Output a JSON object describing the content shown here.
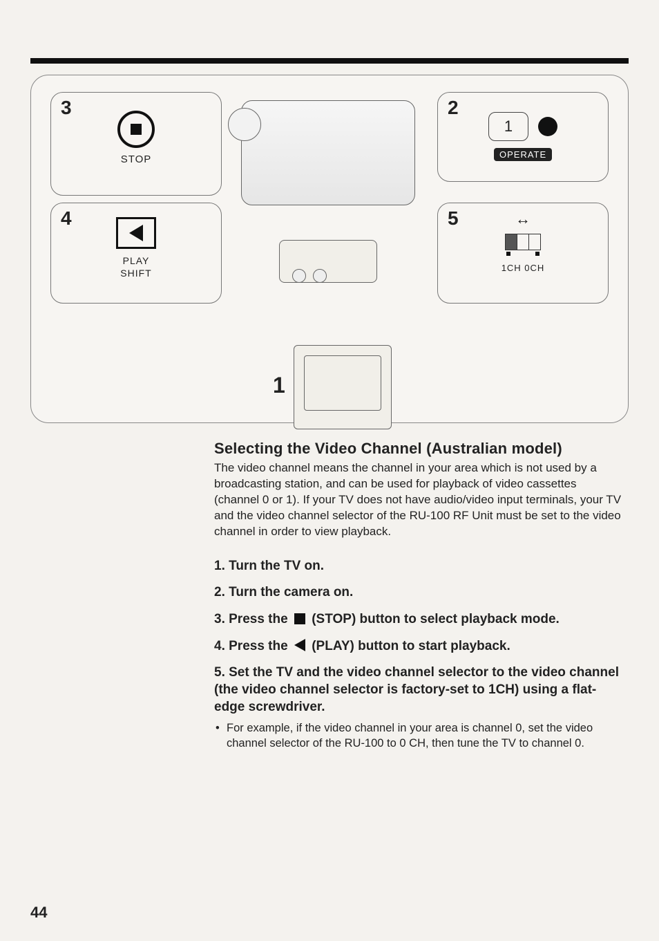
{
  "page_number": "44",
  "figure": {
    "callout3": {
      "num": "3",
      "label": "STOP"
    },
    "callout4": {
      "num": "4",
      "label1": "PLAY",
      "label2": "SHIFT"
    },
    "callout2": {
      "num": "2",
      "card": "1",
      "operate": "OPERATE"
    },
    "callout5": {
      "num": "5",
      "ch_label": "1CH  0CH"
    },
    "center_label": "1"
  },
  "heading": "Selecting the Video Channel (Australian model)",
  "intro": "The video channel means the channel in your area which is not used by a broadcasting station, and can be used for playback of video cassettes (channel 0 or 1). If your TV does not have audio/video input terminals, your TV and the video channel selector of the RU-100 RF Unit must be set to the video channel in order to view playback.",
  "steps": {
    "s1": "1. Turn the TV on.",
    "s2": "2. Turn the camera on.",
    "s3a": "3. Press the ",
    "s3b": " (STOP) button to select playback mode.",
    "s4a": "4. Press the ",
    "s4b": " (PLAY) button to start playback.",
    "s5": "5. Set the TV and the video channel selector to the video channel (the video channel selector is factory-set to 1CH) using a flat-edge screwdriver.",
    "s5_bullet": "For example, if the video channel in your area is channel 0, set the video channel selector of the RU-100 to 0 CH, then tune the TV to channel 0."
  }
}
